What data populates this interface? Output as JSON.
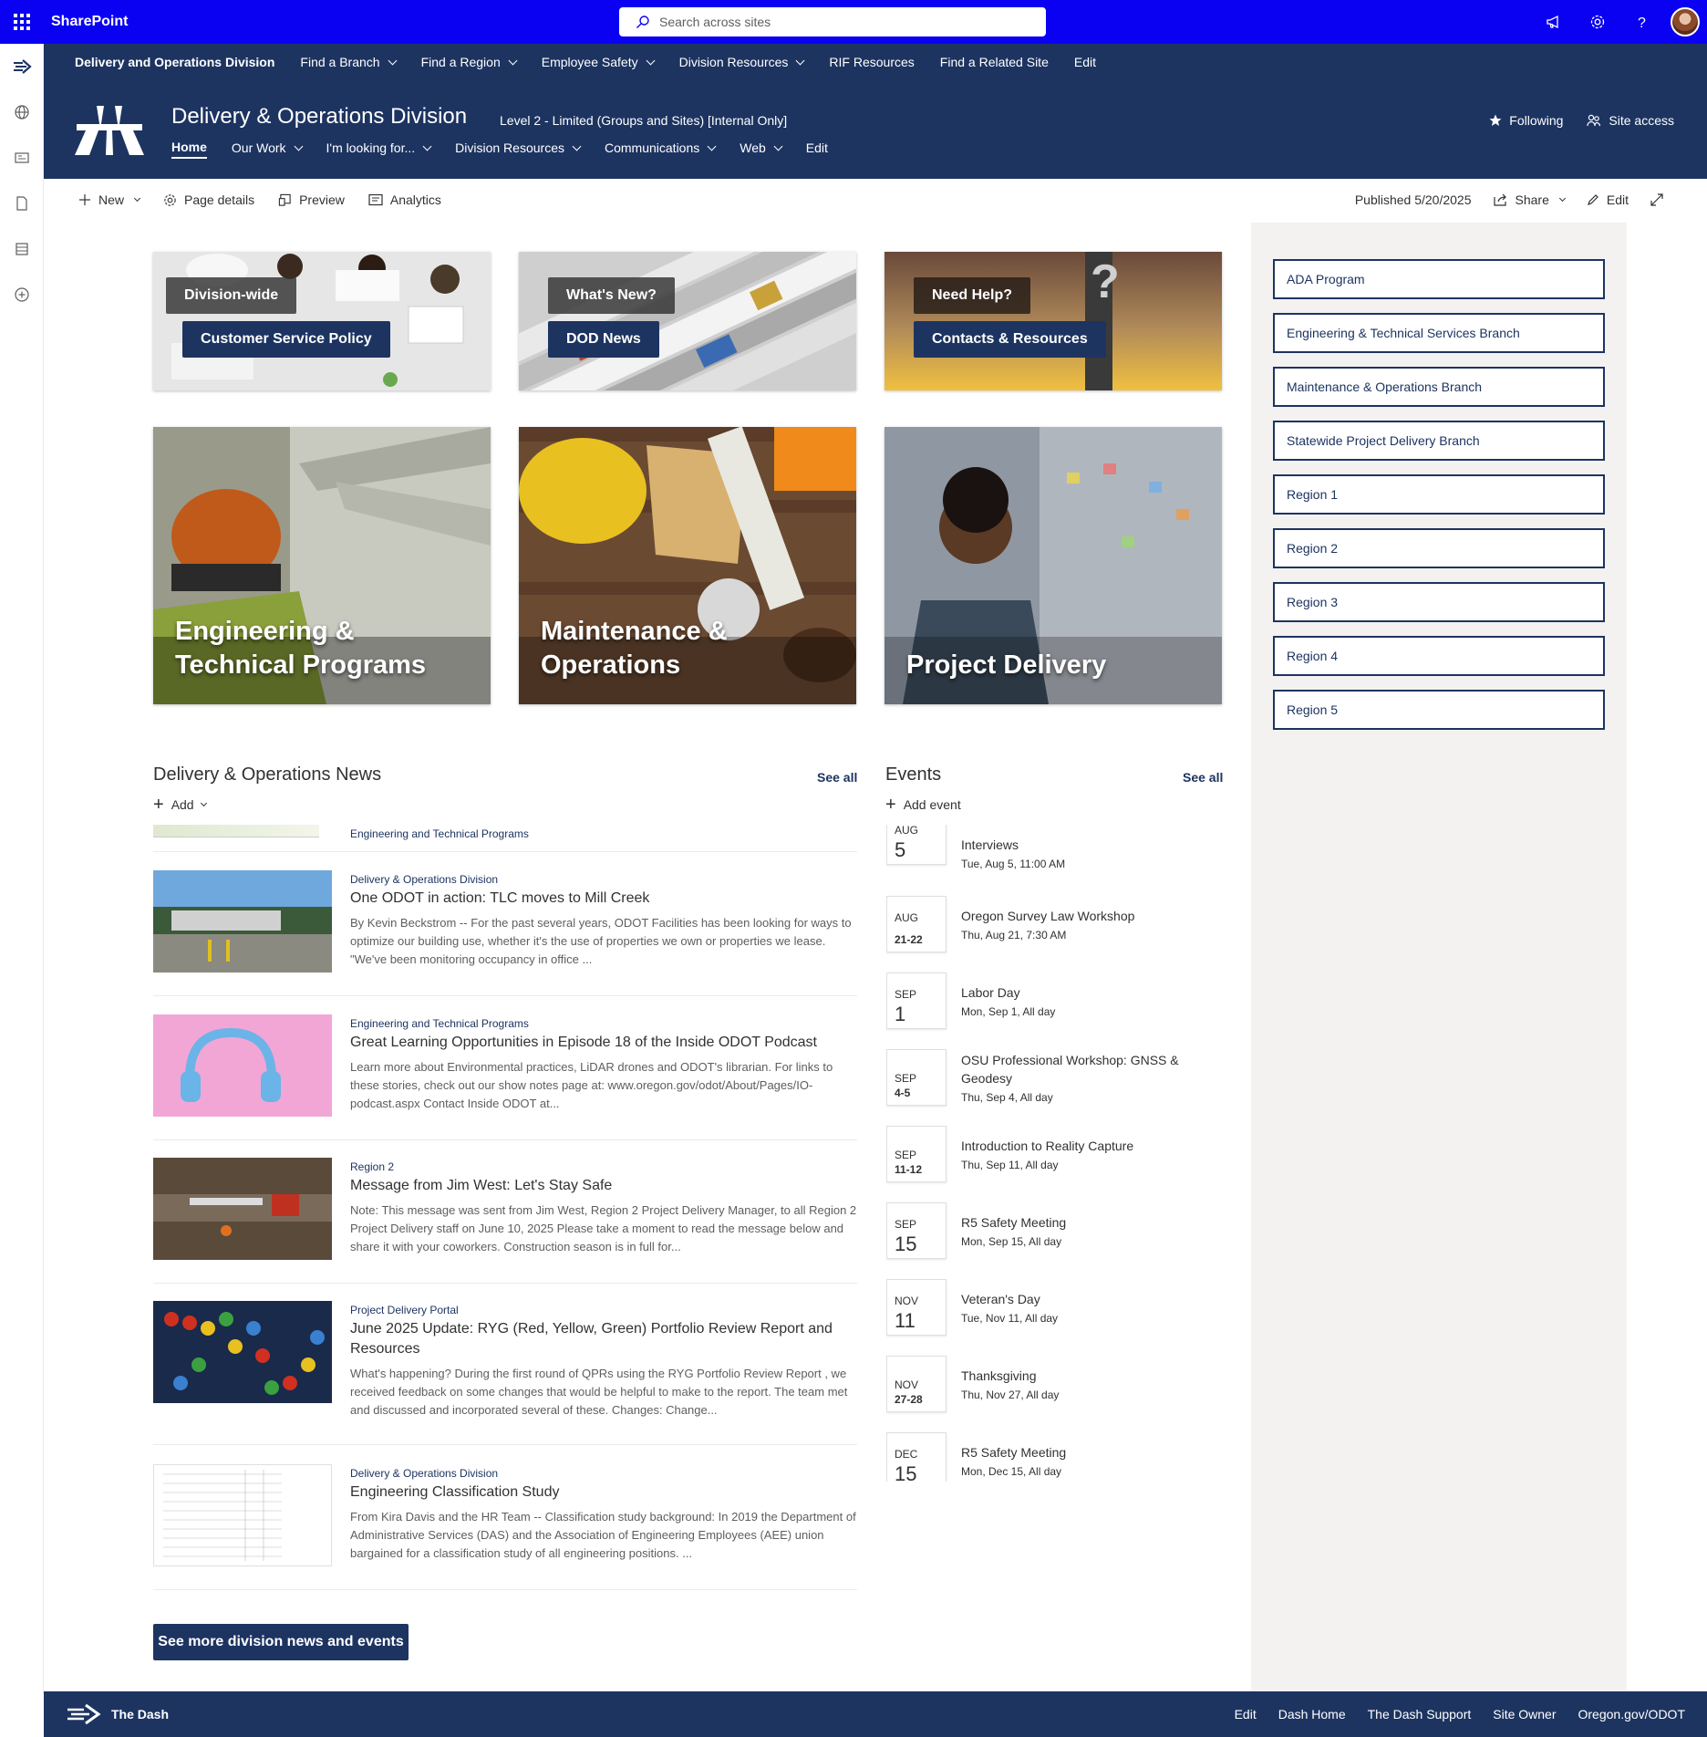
{
  "suitebar": {
    "app_name": "SharePoint",
    "search_placeholder": "Search across sites",
    "bg_color": "#0a00f2"
  },
  "hub": {
    "title": "Delivery and Operations Division",
    "items": [
      {
        "label": "Find a Branch",
        "has_dropdown": true
      },
      {
        "label": "Find a Region",
        "has_dropdown": true
      },
      {
        "label": "Employee Safety",
        "has_dropdown": true
      },
      {
        "label": "Division Resources",
        "has_dropdown": true
      },
      {
        "label": "RIF Resources",
        "has_dropdown": false
      },
      {
        "label": "Find a Related Site",
        "has_dropdown": false
      },
      {
        "label": "Edit",
        "has_dropdown": false
      }
    ]
  },
  "site": {
    "title": "Delivery & Operations Division",
    "classification": "Level 2 - Limited (Groups and Sites) [Internal Only]",
    "nav": [
      {
        "label": "Home",
        "active": true,
        "has_dropdown": false
      },
      {
        "label": "Our Work",
        "active": false,
        "has_dropdown": true
      },
      {
        "label": "I'm looking for...",
        "active": false,
        "has_dropdown": true
      },
      {
        "label": "Division Resources",
        "active": false,
        "has_dropdown": true
      },
      {
        "label": "Communications",
        "active": false,
        "has_dropdown": true
      },
      {
        "label": "Web",
        "active": false,
        "has_dropdown": true
      },
      {
        "label": "Edit",
        "active": false,
        "has_dropdown": false
      }
    ],
    "following_label": "Following",
    "site_access_label": "Site access",
    "theme_color": "#1d3461"
  },
  "commandbar": {
    "new_label": "New",
    "page_details_label": "Page details",
    "preview_label": "Preview",
    "analytics_label": "Analytics",
    "published": "Published 5/20/2025",
    "share_label": "Share",
    "edit_label": "Edit"
  },
  "tiles_small": [
    {
      "top_label": "Division-wide",
      "bottom_label": "Customer Service Policy"
    },
    {
      "top_label": "What's New?",
      "bottom_label": "DOD News"
    },
    {
      "top_label": "Need Help?",
      "bottom_label": "Contacts & Resources"
    }
  ],
  "tiles_large": [
    {
      "label": "Engineering & Technical Programs"
    },
    {
      "label": "Maintenance & Operations"
    },
    {
      "label": "Project Delivery"
    }
  ],
  "quick_links": [
    "ADA Program",
    "Engineering & Technical Services Branch",
    "Maintenance & Operations Branch",
    "Statewide Project Delivery Branch",
    "Region 1",
    "Region 2",
    "Region 3",
    "Region 4",
    "Region 5"
  ],
  "news": {
    "title": "Delivery & Operations News",
    "see_all": "See all",
    "add_label": "Add",
    "partial_category": "Engineering and Technical Programs",
    "items": [
      {
        "category": "Delivery & Operations Division",
        "title": "One ODOT in action: TLC moves to Mill Creek",
        "description": "By Kevin Beckstrom -- For the past several years, ODOT Facilities has been looking for ways to optimize our building use, whether it's the use of properties we own or properties we lease. \"We've been monitoring occupancy in office ..."
      },
      {
        "category": "Engineering and Technical Programs",
        "title": "Great Learning Opportunities in Episode 18 of the Inside ODOT Podcast",
        "description": "Learn more about Environmental practices, LiDAR drones and ODOT's librarian. For links to these stories, check out our show notes page at: www.oregon.gov/odot/About/Pages/IO-podcast.aspx Contact Inside ODOT at..."
      },
      {
        "category": "Region 2",
        "title": "Message from Jim West: Let's Stay Safe",
        "description": "Note: This message was sent from Jim West, Region 2 Project Delivery Manager, to all Region 2 Project Delivery staff on June 10, 2025 Please take a moment to read the message below and share it with your coworkers. Construction season is in full for..."
      },
      {
        "category": "Project Delivery Portal",
        "title": "June 2025 Update: RYG (Red, Yellow, Green) Portfolio Review Report and Resources",
        "description": "What's happening? During the first round of QPRs using the RYG Portfolio Review Report , we received feedback on some changes that would be helpful to make to the report. The team met and discussed and incorporated several of these. Changes: Change..."
      },
      {
        "category": "Delivery & Operations Division",
        "title": "Engineering Classification Study",
        "description": "From Kira Davis and the HR Team -- Classification study background: In 2019 the Department of Administrative Services (DAS) and the Association of Engineering Employees (AEE) union bargained for a classification study of all engineering positions. ..."
      }
    ]
  },
  "events": {
    "title": "Events",
    "see_all": "See all",
    "add_label": "Add event",
    "items": [
      {
        "month": "AUG",
        "day": "5",
        "title": "Interviews",
        "time": "Tue, Aug 5, 11:00 AM"
      },
      {
        "month": "AUG",
        "day": "21-22",
        "title": "Oregon Survey Law Workshop",
        "time": "Thu, Aug 21, 7:30 AM"
      },
      {
        "month": "SEP",
        "day": "1",
        "title": "Labor Day",
        "time": "Mon, Sep 1, All day"
      },
      {
        "month": "SEP",
        "day": "4-5",
        "title": "OSU Professional Workshop: GNSS & Geodesy",
        "time": "Thu, Sep 4, All day"
      },
      {
        "month": "SEP",
        "day": "11-12",
        "title": "Introduction to Reality Capture",
        "time": "Thu, Sep 11, All day"
      },
      {
        "month": "SEP",
        "day": "15",
        "title": "R5 Safety Meeting",
        "time": "Mon, Sep 15, All day"
      },
      {
        "month": "NOV",
        "day": "11",
        "title": "Veteran's Day",
        "time": "Tue, Nov 11, All day"
      },
      {
        "month": "NOV",
        "day": "27-28",
        "title": "Thanksgiving",
        "time": "Thu, Nov 27, All day"
      },
      {
        "month": "DEC",
        "day": "15",
        "title": "R5 Safety Meeting",
        "time": "Mon, Dec 15, All day"
      }
    ]
  },
  "more_button": "See more division news and events",
  "footer": {
    "brand": "The Dash",
    "links": [
      "Edit",
      "Dash Home",
      "The Dash Support",
      "Site Owner",
      "Oregon.gov/ODOT"
    ]
  }
}
